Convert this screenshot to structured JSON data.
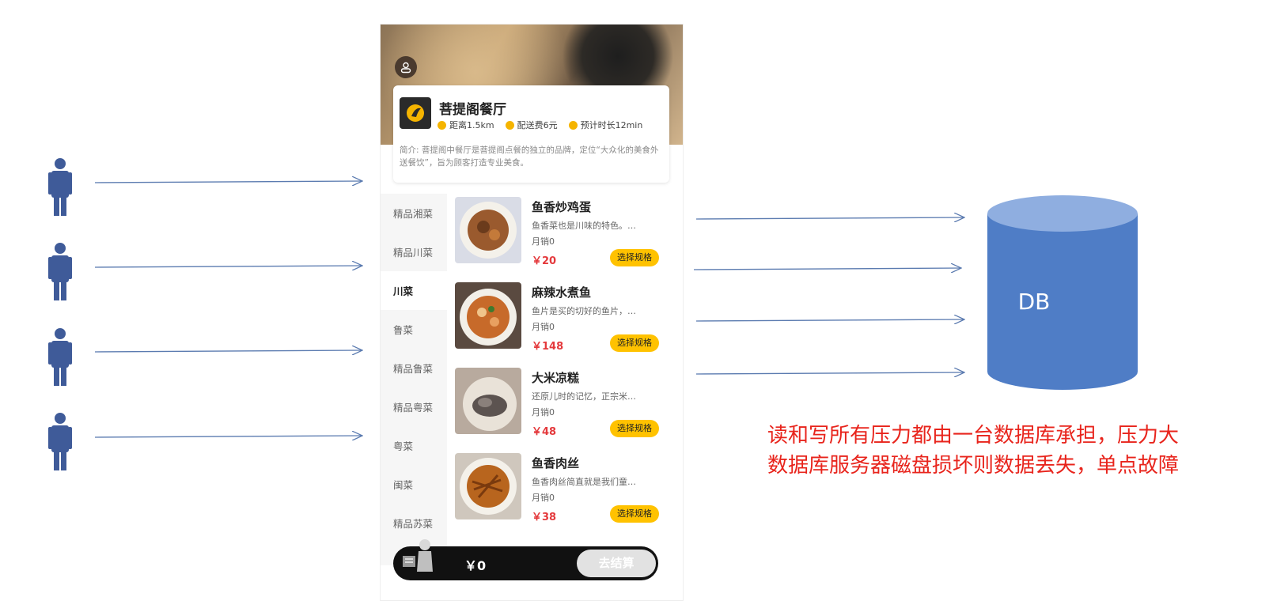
{
  "store": {
    "name": "菩提阁餐厅",
    "distance": "距离1.5km",
    "delivery_fee": "配送费6元",
    "eta": "预计时长12min",
    "intro": "简介: 菩提阁中餐厅是菩提阁点餐的独立的品牌，定位“大众化的美食外送餐饮”，旨为顾客打造专业美食。"
  },
  "categories": [
    "精品湘菜",
    "精品川菜",
    "川菜",
    "鲁菜",
    "精品鲁菜",
    "精品粤菜",
    "粤菜",
    "闽菜",
    "精品苏菜"
  ],
  "active_category": "川菜",
  "dishes": [
    {
      "name": "鱼香炒鸡蛋",
      "desc": "鱼香菜也是川味的特色。…",
      "sales": "月销0",
      "price": "￥20",
      "button": "选择规格"
    },
    {
      "name": "麻辣水煮鱼",
      "desc": "鱼片是买的切好的鱼片，…",
      "sales": "月销0",
      "price": "￥148",
      "button": "选择规格"
    },
    {
      "name": "大米凉糕",
      "desc": "还原儿时的记忆，正宗米…",
      "sales": "月销0",
      "price": "￥48",
      "button": "选择规格"
    },
    {
      "name": "鱼香肉丝",
      "desc": "鱼香肉丝简直就是我们童…",
      "sales": "月销0",
      "price": "￥38",
      "button": "选择规格"
    }
  ],
  "cart": {
    "total": "￥0",
    "checkout": "去结算"
  },
  "db_label": "DB",
  "note": {
    "line1": "读和写所有压力都由一台数据库承担，压力大",
    "line2": "数据库服务器磁盘损坏则数据丢失，单点故障"
  },
  "colors": {
    "arrow": "#5b7bb0",
    "user": "#3f5b99",
    "db_body": "#4f7dc6",
    "db_top": "#8faee0",
    "note": "#e8241c",
    "accent": "#ffc200"
  }
}
